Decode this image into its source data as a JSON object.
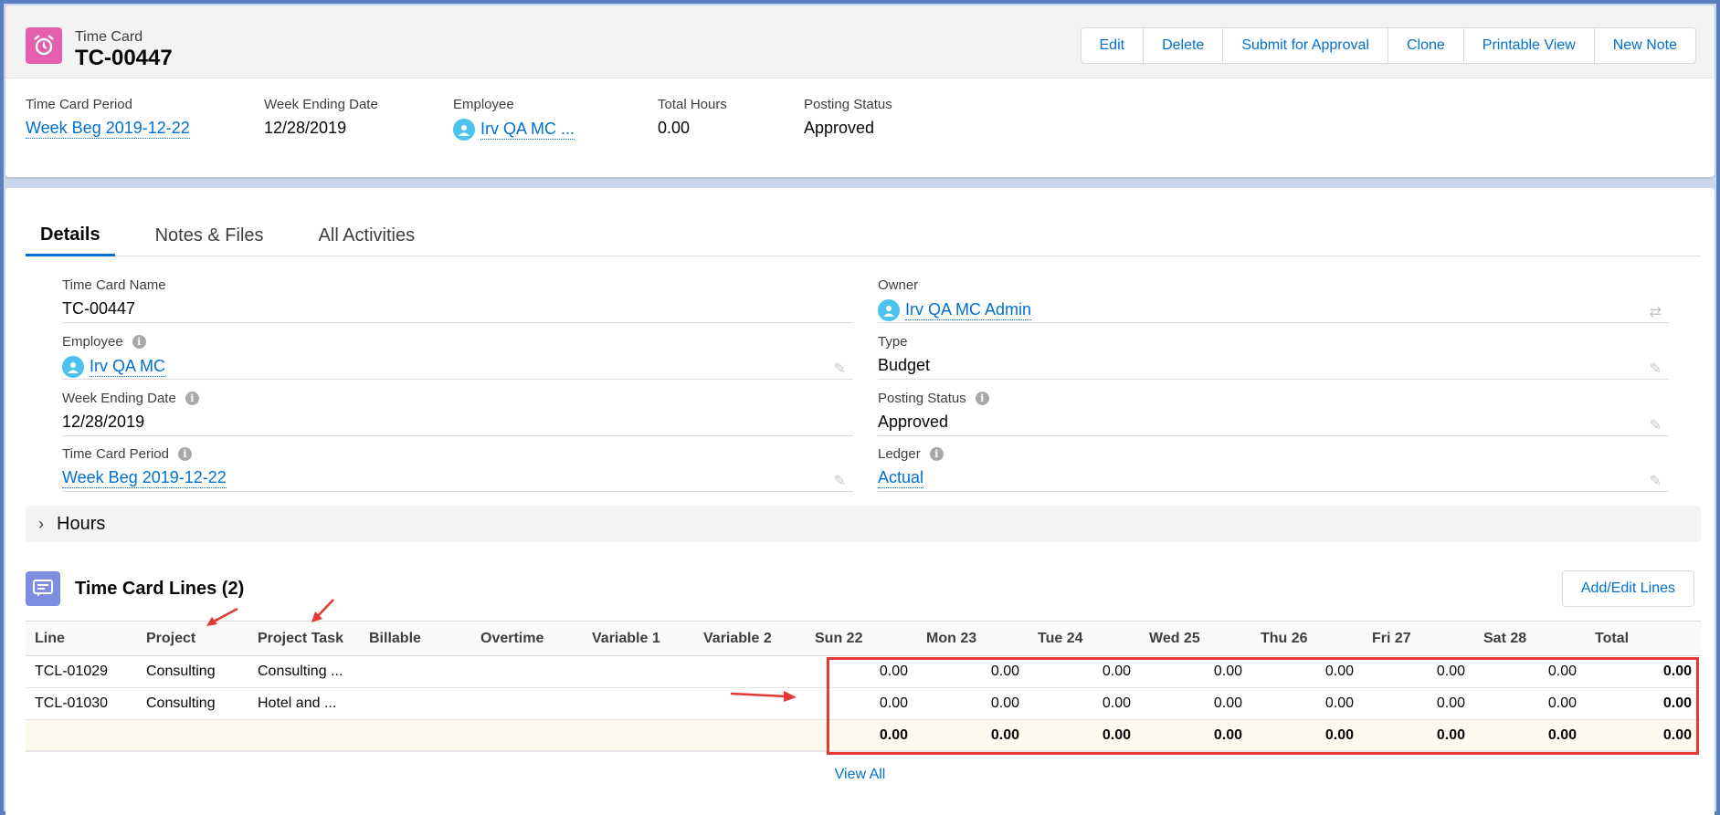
{
  "header": {
    "object_label": "Time Card",
    "record_name": "TC-00447",
    "icon": "alarm-clock-icon",
    "buttons": [
      "Edit",
      "Delete",
      "Submit for Approval",
      "Clone",
      "Printable View",
      "New Note"
    ]
  },
  "highlights": [
    {
      "label": "Time Card Period",
      "value": "Week Beg 2019-12-22",
      "link": true
    },
    {
      "label": "Week Ending Date",
      "value": "12/28/2019",
      "link": false
    },
    {
      "label": "Employee",
      "value": "Irv QA MC ...",
      "link": true,
      "avatar": true
    },
    {
      "label": "Total Hours",
      "value": "0.00",
      "link": false
    },
    {
      "label": "Posting Status",
      "value": "Approved",
      "link": false
    }
  ],
  "tabs": [
    "Details",
    "Notes & Files",
    "All Activities"
  ],
  "details": {
    "left": [
      {
        "label": "Time Card Name",
        "value": "TC-00447"
      },
      {
        "label": "Employee",
        "value": "Irv QA MC"
      },
      {
        "label": "Week Ending Date",
        "value": "12/28/2019"
      },
      {
        "label": "Time Card Period",
        "value": "Week Beg 2019-12-22"
      }
    ],
    "right": [
      {
        "label": "Owner",
        "value": "Irv QA MC Admin"
      },
      {
        "label": "Type",
        "value": "Budget"
      },
      {
        "label": "Posting Status",
        "value": "Approved"
      },
      {
        "label": "Ledger",
        "value": "Actual"
      }
    ]
  },
  "hours_section": {
    "title": "Hours"
  },
  "lines": {
    "title": "Time Card Lines (2)",
    "add_button": "Add/Edit Lines",
    "columns": [
      "Line",
      "Project",
      "Project Task",
      "Billable",
      "Overtime",
      "Variable 1",
      "Variable 2",
      "Sun 22",
      "Mon 23",
      "Tue 24",
      "Wed 25",
      "Thu 26",
      "Fri 27",
      "Sat 28",
      "Total"
    ],
    "rows": [
      [
        "TCL-01029",
        "Consulting",
        "Consulting ...",
        "",
        "",
        "",
        "",
        "0.00",
        "0.00",
        "0.00",
        "0.00",
        "0.00",
        "0.00",
        "0.00",
        "0.00"
      ],
      [
        "TCL-01030",
        "Consulting",
        "Hotel and ...",
        "",
        "",
        "",
        "",
        "0.00",
        "0.00",
        "0.00",
        "0.00",
        "0.00",
        "0.00",
        "0.00",
        "0.00"
      ]
    ],
    "totals": [
      "",
      "",
      "",
      "",
      "",
      "",
      "",
      "0.00",
      "0.00",
      "0.00",
      "0.00",
      "0.00",
      "0.00",
      "0.00",
      "0.00"
    ],
    "view_all": "View All"
  },
  "colors": {
    "brand_link": "#0070d2",
    "timecard_icon": "#e35fae",
    "lines_icon": "#7f8de1",
    "annotation": "#e53935"
  }
}
